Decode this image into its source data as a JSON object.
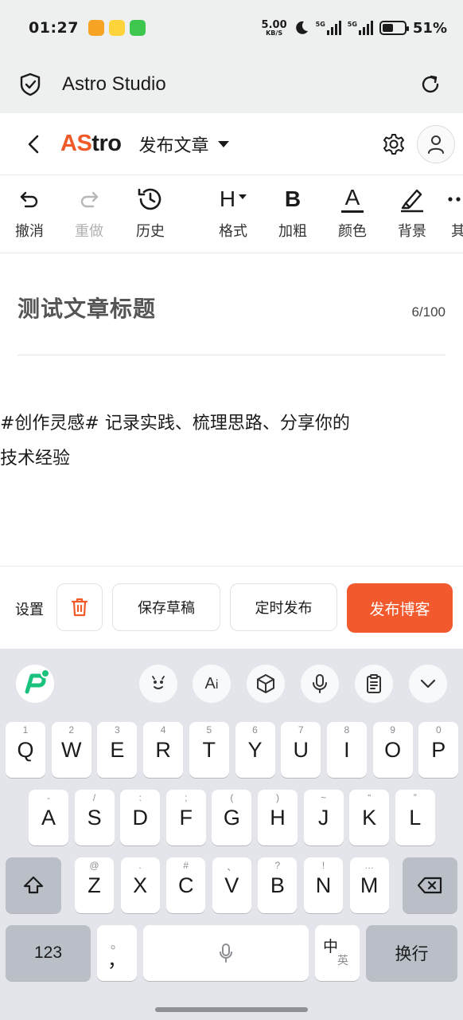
{
  "status_bar": {
    "time": "01:27",
    "net_speed": "5.00",
    "net_speed_unit": "KB/S",
    "net1": "5G",
    "net2": "5G",
    "battery_percent": "51%",
    "battery_level": 0.51,
    "app_icon_colors": [
      "#f7a324",
      "#ffd43a",
      "#3ec64f"
    ]
  },
  "browser": {
    "title": "Astro Studio"
  },
  "header": {
    "logo_accent": "AS",
    "logo_rest": "tro",
    "page_label": "发布文章",
    "brand_color": "#f05a28"
  },
  "toolbar": {
    "items": [
      {
        "label": "撤消",
        "icon": "undo-icon",
        "disabled": false
      },
      {
        "label": "重做",
        "icon": "redo-icon",
        "disabled": true
      },
      {
        "label": "历史",
        "icon": "history-icon",
        "disabled": false
      },
      {
        "label": "格式",
        "icon": "heading-icon",
        "icon_text": "H",
        "disabled": false
      },
      {
        "label": "加粗",
        "icon": "bold-icon",
        "icon_text": "B",
        "disabled": false
      },
      {
        "label": "颜色",
        "icon": "text-color-icon",
        "icon_text": "A",
        "disabled": false
      },
      {
        "label": "背景",
        "icon": "highlight-icon",
        "disabled": false
      },
      {
        "label": "其",
        "icon": "more-icon",
        "disabled": false
      }
    ]
  },
  "editor": {
    "title": "测试文章标题",
    "title_count": "6/100",
    "body_line1": "#创作灵感# 记录实践、梳理思路、分享你的",
    "body_line2": "技术经验"
  },
  "actions": {
    "settings_label": "设置",
    "save_draft": "保存草稿",
    "schedule": "定时发布",
    "publish": "发布博客",
    "publish_color": "#f25a2e"
  },
  "keyboard": {
    "row1": [
      {
        "key": "Q",
        "sub": "1"
      },
      {
        "key": "W",
        "sub": "2"
      },
      {
        "key": "E",
        "sub": "3"
      },
      {
        "key": "R",
        "sub": "4"
      },
      {
        "key": "T",
        "sub": "5"
      },
      {
        "key": "Y",
        "sub": "6"
      },
      {
        "key": "U",
        "sub": "7"
      },
      {
        "key": "I",
        "sub": "8"
      },
      {
        "key": "O",
        "sub": "9"
      },
      {
        "key": "P",
        "sub": "0"
      }
    ],
    "row2": [
      {
        "key": "A",
        "sub": "-"
      },
      {
        "key": "S",
        "sub": "/"
      },
      {
        "key": "D",
        "sub": ":"
      },
      {
        "key": "F",
        "sub": ";"
      },
      {
        "key": "G",
        "sub": "("
      },
      {
        "key": "H",
        "sub": ")"
      },
      {
        "key": "J",
        "sub": "~"
      },
      {
        "key": "K",
        "sub": "“"
      },
      {
        "key": "L",
        "sub": "”"
      }
    ],
    "row3": [
      {
        "key": "Z",
        "sub": "@"
      },
      {
        "key": "X",
        "sub": "."
      },
      {
        "key": "C",
        "sub": "#"
      },
      {
        "key": "V",
        "sub": "、"
      },
      {
        "key": "B",
        "sub": "?"
      },
      {
        "key": "N",
        "sub": "!"
      },
      {
        "key": "M",
        "sub": "…"
      }
    ],
    "num_key": "123",
    "punct_key": "，",
    "punct_sub": "。",
    "lang_main": "中",
    "lang_sub": "英",
    "enter_key": "换行"
  }
}
